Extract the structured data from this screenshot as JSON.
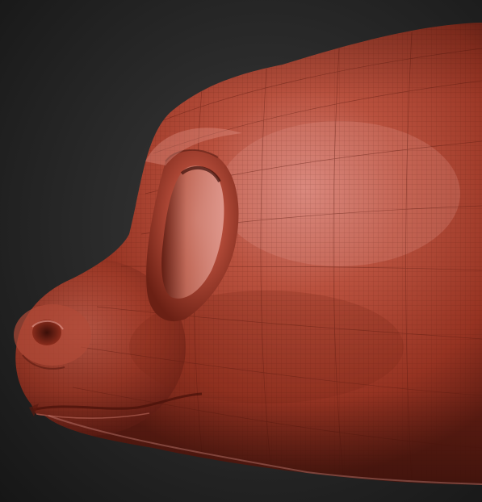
{
  "scene": {
    "subject": "sculpted-creature-head",
    "colors": {
      "background_center": "#3a3a3a",
      "background_edge": "#161616",
      "clay_base": "#a8402c",
      "clay_highlight": "#d8786a",
      "clay_shadow": "#4a150d",
      "wireframe": "#5a1a10"
    }
  }
}
